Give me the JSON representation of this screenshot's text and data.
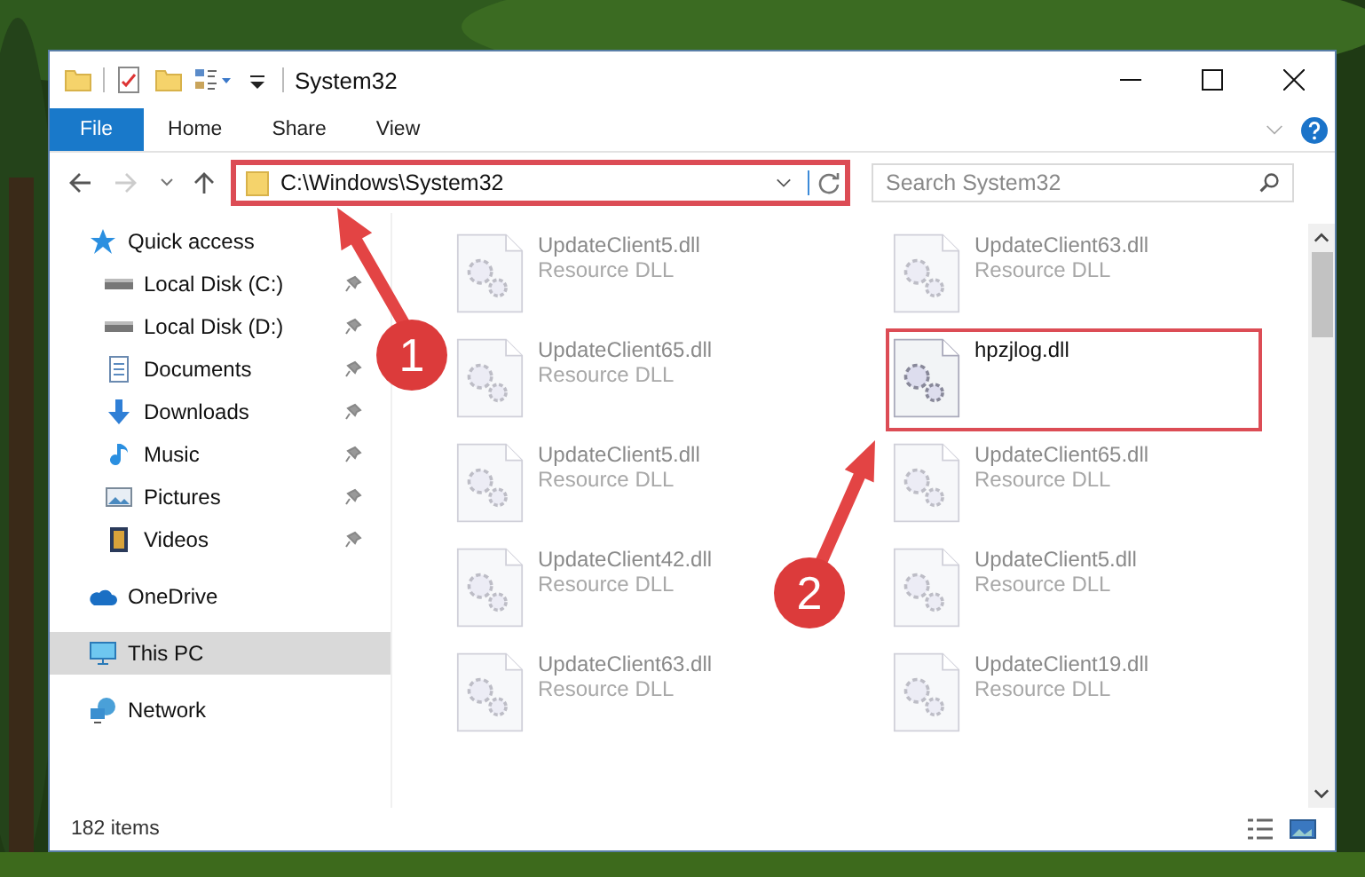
{
  "window": {
    "title": "System32"
  },
  "ribbon_tabs": [
    {
      "label": "File",
      "selected": true
    },
    {
      "label": "Home",
      "selected": false
    },
    {
      "label": "Share",
      "selected": false
    },
    {
      "label": "View",
      "selected": false
    }
  ],
  "address_bar": {
    "path": "C:\\Windows\\System32",
    "highlighted": true
  },
  "search": {
    "placeholder": "Search System32"
  },
  "navigation": [
    {
      "label": "Quick access",
      "kind": "star",
      "selected": false,
      "children": [
        {
          "label": "Local Disk (C:)",
          "kind": "disk",
          "pinned": true
        },
        {
          "label": "Local Disk (D:)",
          "kind": "disk",
          "pinned": true
        },
        {
          "label": "Documents",
          "kind": "documents",
          "pinned": true
        },
        {
          "label": "Downloads",
          "kind": "downloads",
          "pinned": true
        },
        {
          "label": "Music",
          "kind": "music",
          "pinned": true
        },
        {
          "label": "Pictures",
          "kind": "pictures",
          "pinned": true
        },
        {
          "label": "Videos",
          "kind": "videos",
          "pinned": true
        }
      ]
    },
    {
      "label": "OneDrive",
      "kind": "cloud",
      "selected": false
    },
    {
      "label": "This PC",
      "kind": "pc",
      "selected": true
    },
    {
      "label": "Network",
      "kind": "network",
      "selected": false
    }
  ],
  "files": [
    {
      "name": "UpdateClient5.dll",
      "type": "Resource DLL",
      "blurred": true,
      "highlighted": false
    },
    {
      "name": "UpdateClient63.dll",
      "type": "Resource DLL",
      "blurred": true,
      "highlighted": false
    },
    {
      "name": "UpdateClient65.dll",
      "type": "Resource DLL",
      "blurred": true,
      "highlighted": false
    },
    {
      "name": "hpzjlog.dll",
      "blurred": false,
      "highlighted": true
    },
    {
      "name": "UpdateClient5.dll",
      "type": "Resource DLL",
      "blurred": true,
      "highlighted": false
    },
    {
      "name": "UpdateClient65.dll",
      "type": "Resource DLL",
      "blurred": true,
      "highlighted": false
    },
    {
      "name": "UpdateClient42.dll",
      "type": "Resource DLL",
      "blurred": true,
      "highlighted": false
    },
    {
      "name": "UpdateClient5.dll",
      "type": "Resource DLL",
      "blurred": true,
      "highlighted": false
    },
    {
      "name": "UpdateClient63.dll",
      "type": "Resource DLL",
      "blurred": true,
      "highlighted": false
    },
    {
      "name": "UpdateClient19.dll",
      "type": "Resource DLL",
      "blurred": true,
      "highlighted": false
    }
  ],
  "status_bar": {
    "item_count": "182 items"
  },
  "annotations": [
    {
      "number": "1"
    },
    {
      "number": "2"
    }
  ]
}
